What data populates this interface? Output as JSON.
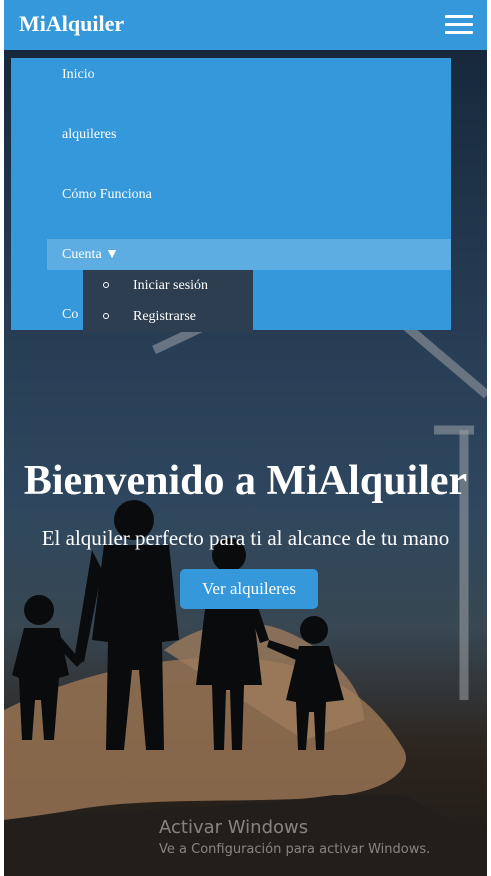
{
  "header": {
    "brand": "MiAlquiler",
    "menu_icon": "hamburger-menu-icon",
    "background_color": "#3498db"
  },
  "nav": {
    "items": [
      {
        "label": "Inicio"
      },
      {
        "label": "alquileres"
      },
      {
        "label": "Cómo Funciona"
      },
      {
        "label": "Cuenta ▼"
      },
      {
        "label": "Co"
      }
    ],
    "submenu": [
      {
        "label": "Iniciar sesión"
      },
      {
        "label": "Registrarse"
      }
    ]
  },
  "hero": {
    "title": "Bienvenido a MiAlquiler",
    "subtitle": "El alquiler perfecto para ti al alcance de tu mano",
    "cta_label": "Ver alquileres"
  },
  "watermark": {
    "title": "Activar Windows",
    "subtitle": "Ve a Configuración para activar Windows."
  }
}
